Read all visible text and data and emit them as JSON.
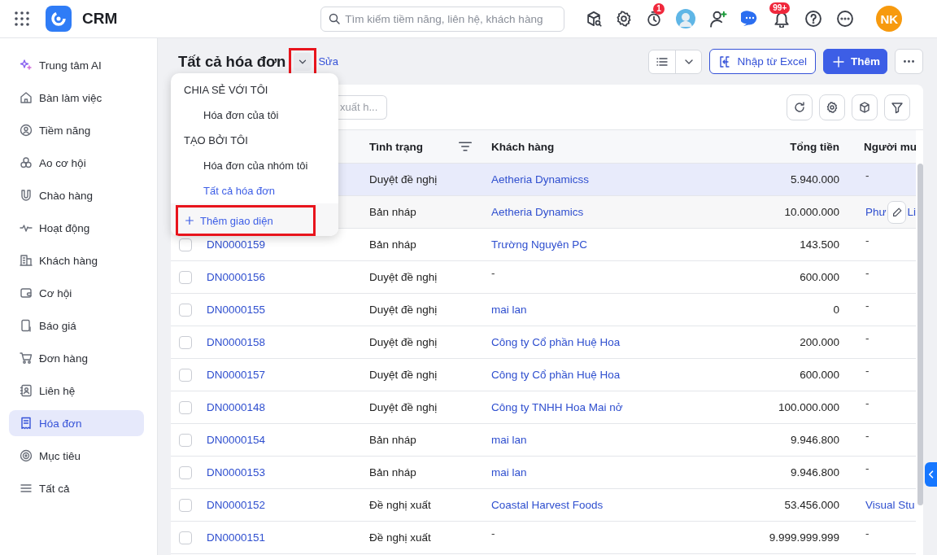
{
  "app": {
    "title": "CRM"
  },
  "search": {
    "placeholder": "Tìm kiếm tiềm năng, liên hệ, khách hàng"
  },
  "header": {
    "timer_badge": "1",
    "bell_badge": "99+",
    "user_initials": "NK"
  },
  "sidebar": {
    "items": [
      {
        "label": "Trung tâm AI",
        "selected": false
      },
      {
        "label": "Bàn làm việc",
        "selected": false
      },
      {
        "label": "Tiềm năng",
        "selected": false
      },
      {
        "label": "Ao cơ hội",
        "selected": false
      },
      {
        "label": "Chào hàng",
        "selected": false
      },
      {
        "label": "Hoạt động",
        "selected": false
      },
      {
        "label": "Khách hàng",
        "selected": false
      },
      {
        "label": "Cơ hội",
        "selected": false
      },
      {
        "label": "Báo giá",
        "selected": false
      },
      {
        "label": "Đơn hàng",
        "selected": false
      },
      {
        "label": "Liên hệ",
        "selected": false
      },
      {
        "label": "Hóa đơn",
        "selected": true
      },
      {
        "label": "Mục tiêu",
        "selected": false
      },
      {
        "label": "Tất cả",
        "selected": false
      }
    ]
  },
  "page": {
    "title": "Tất cả hóa đơn",
    "edit_link": "Sửa",
    "view_toggle_annotated": true
  },
  "actions": {
    "import": "Nhập từ Excel",
    "add": "Thêm"
  },
  "view_menu": {
    "groups": [
      {
        "heading": "CHIA SẺ VỚI TÔI",
        "items": [
          {
            "label": "Hóa đơn của tôi",
            "selected": false
          }
        ]
      },
      {
        "heading": "TẠO BỞI TÔI",
        "items": [
          {
            "label": "Hóa đơn của nhóm tôi",
            "selected": false
          },
          {
            "label": "Tất cả hóa đơn",
            "selected": true
          }
        ]
      }
    ],
    "add_view": {
      "label": "Thêm giao diện",
      "annotated": true
    }
  },
  "table_search": {
    "placeholder": "xuất h..."
  },
  "table": {
    "columns": [
      {
        "label": "Tình trạng",
        "filter": true
      },
      {
        "label": "Khách hàng"
      },
      {
        "label": "Tổng tiền"
      },
      {
        "label": "Người mu"
      }
    ],
    "rows": [
      {
        "status": "Duyệt đề nghị",
        "customer": {
          "text": "Aetheria Dynamicss",
          "link": true
        },
        "total": "5.940.000",
        "buyer": {
          "text": "-",
          "link": false
        },
        "selected": true
      },
      {
        "status": "Bản nháp",
        "customer": {
          "text": "Aetheria Dynamics",
          "link": true
        },
        "total": "10.000.000",
        "buyer": {
          "text": "Phư",
          "end": "Li",
          "link": true
        },
        "editing": true,
        "selected": false
      },
      {
        "id": "DN0000159",
        "checked": false,
        "status": "Bản nháp",
        "customer": {
          "text": "Trường Nguyên PC",
          "link": true
        },
        "total": "143.500",
        "buyer": {
          "text": "-",
          "link": false
        },
        "selected": false
      },
      {
        "id": "DN0000156",
        "checked": false,
        "status": "Duyệt đề nghị",
        "customer": {
          "text": "-",
          "link": false
        },
        "total": "600.000",
        "buyer": {
          "text": "-",
          "link": false
        },
        "selected": false
      },
      {
        "id": "DN0000155",
        "checked": false,
        "status": "Duyệt đề nghị",
        "customer": {
          "text": "mai lan",
          "link": true
        },
        "total": "0",
        "buyer": {
          "text": "-",
          "link": false
        },
        "selected": false
      },
      {
        "id": "DN0000158",
        "checked": false,
        "status": "Duyệt đề nghị",
        "customer": {
          "text": "Công ty Cổ phần Huệ Hoa",
          "link": true
        },
        "total": "200.000",
        "buyer": {
          "text": "-",
          "link": false
        },
        "selected": false
      },
      {
        "id": "DN0000157",
        "checked": false,
        "status": "Duyệt đề nghị",
        "customer": {
          "text": "Công ty Cổ phần Huệ Hoa",
          "link": true
        },
        "total": "600.000",
        "buyer": {
          "text": "-",
          "link": false
        },
        "selected": false
      },
      {
        "id": "DN0000148",
        "checked": false,
        "status": "Duyệt đề nghị",
        "customer": {
          "text": "Công ty TNHH Hoa Mai nở",
          "link": true
        },
        "total": "100.000.000",
        "buyer": {
          "text": "-",
          "link": false
        },
        "selected": false
      },
      {
        "id": "DN0000154",
        "checked": false,
        "status": "Bản nháp",
        "customer": {
          "text": "mai lan",
          "link": true
        },
        "total": "9.946.800",
        "buyer": {
          "text": "-",
          "link": false
        },
        "selected": false
      },
      {
        "id": "DN0000153",
        "checked": false,
        "status": "Bản nháp",
        "customer": {
          "text": "mai lan",
          "link": true
        },
        "total": "9.946.800",
        "buyer": {
          "text": "-",
          "link": false
        },
        "selected": false
      },
      {
        "id": "DN0000152",
        "checked": false,
        "status": "Đề nghị xuất",
        "customer": {
          "text": "Coastal Harvest Foods",
          "link": true
        },
        "total": "53.456.000",
        "buyer": {
          "text": "Visual Stu",
          "link": true
        },
        "selected": false
      },
      {
        "id": "DN0000151",
        "checked": false,
        "status": "Đề nghị xuất",
        "customer": {
          "text": "-",
          "link": false
        },
        "total": "9.999.999.999",
        "buyer": {
          "text": "-",
          "link": false
        },
        "selected": false
      }
    ]
  }
}
